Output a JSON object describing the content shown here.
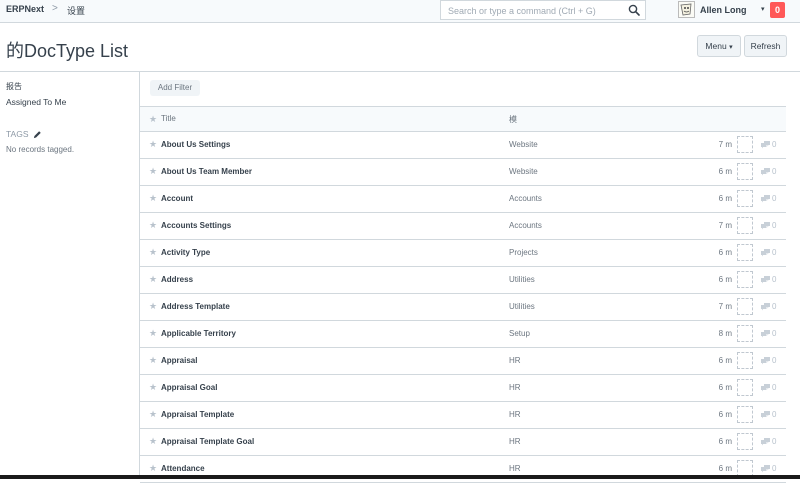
{
  "navbar": {
    "brand": "ERPNext",
    "breadcrumb_separator": ">",
    "breadcrumb": "设置",
    "search_placeholder": "Search or type a command (Ctrl + G)",
    "user_name": "Allen Long",
    "user_caret": "▾",
    "notification_count": "0"
  },
  "page": {
    "title": "的DocType List",
    "menu_label": "Menu",
    "menu_caret": "▾",
    "refresh_label": "Refresh"
  },
  "sidebar": {
    "reports_label": "报告",
    "assigned_label": "Assigned To Me",
    "tags_label": "TAGS",
    "no_records": "No records tagged."
  },
  "list": {
    "add_filter_label": "Add Filter",
    "header": {
      "star": "★",
      "title": "Title",
      "module": "模"
    },
    "rows": [
      {
        "title": "About Us Settings",
        "module": "Website",
        "modified": "7 m",
        "comments": "0"
      },
      {
        "title": "About Us Team Member",
        "module": "Website",
        "modified": "6 m",
        "comments": "0"
      },
      {
        "title": "Account",
        "module": "Accounts",
        "modified": "6 m",
        "comments": "0"
      },
      {
        "title": "Accounts Settings",
        "module": "Accounts",
        "modified": "7 m",
        "comments": "0"
      },
      {
        "title": "Activity Type",
        "module": "Projects",
        "modified": "6 m",
        "comments": "0"
      },
      {
        "title": "Address",
        "module": "Utilities",
        "modified": "6 m",
        "comments": "0"
      },
      {
        "title": "Address Template",
        "module": "Utilities",
        "modified": "7 m",
        "comments": "0"
      },
      {
        "title": "Applicable Territory",
        "module": "Setup",
        "modified": "8 m",
        "comments": "0"
      },
      {
        "title": "Appraisal",
        "module": "HR",
        "modified": "6 m",
        "comments": "0"
      },
      {
        "title": "Appraisal Goal",
        "module": "HR",
        "modified": "6 m",
        "comments": "0"
      },
      {
        "title": "Appraisal Template",
        "module": "HR",
        "modified": "6 m",
        "comments": "0"
      },
      {
        "title": "Appraisal Template Goal",
        "module": "HR",
        "modified": "6 m",
        "comments": "0"
      },
      {
        "title": "Attendance",
        "module": "HR",
        "modified": "6 m",
        "comments": "0"
      }
    ]
  },
  "icons": [
    "search-icon",
    "pencil-icon",
    "star-icon",
    "comment-icon",
    "avatar-icon"
  ],
  "colors": {
    "notification": "#ff5858",
    "border": "#d1d8dd",
    "text": "#36414c",
    "muted": "#6c7680"
  }
}
